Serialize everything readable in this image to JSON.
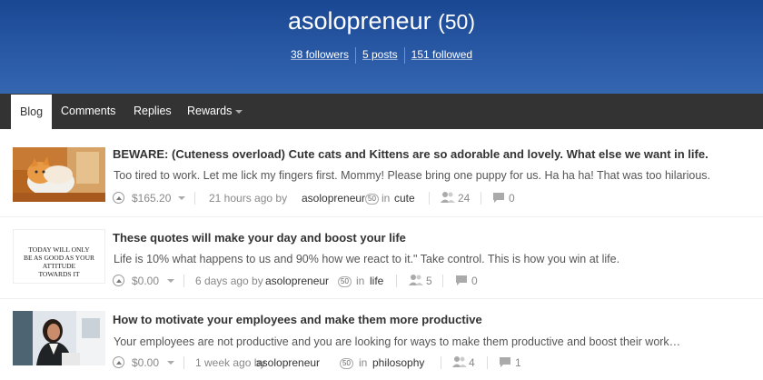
{
  "profile": {
    "username": "asolopreneur",
    "reputation": "(50)",
    "followers": "38 followers",
    "posts": "5 posts",
    "followed": "151 followed"
  },
  "tabs": [
    {
      "label": "Blog",
      "active": true
    },
    {
      "label": "Comments"
    },
    {
      "label": "Replies"
    },
    {
      "label": "Rewards"
    }
  ],
  "posts": [
    {
      "title": "BEWARE: (Cuteness overload) Cute cats and Kittens are so adorable and lovely. What else we want in life.",
      "body": "Too tired to work.   Let me lick my fingers first. Mommy! Please bring one puppy for us. Ha ha ha! That was too hilarious.",
      "payout": "$165.20",
      "time": "21 hours ago by",
      "author": "asolopreneur",
      "author_rep": "50",
      "in": "in",
      "tag": "cute",
      "voters": "24",
      "comments": "0"
    },
    {
      "title": "These quotes will make your day and boost your life",
      "body": "Life is 10% what happens to us and 90% how we react to it.\" Take control.     This is how you win at life.",
      "thumb_text": [
        "TODAY WILL ONLY",
        "BE AS GOOD AS YOUR",
        "ATTITUDE",
        "TOWARDS IT"
      ],
      "payout": "$0.00",
      "time": "6 days ago by",
      "author": "asolopreneur",
      "author_rep": "50",
      "in": "in",
      "tag": "life",
      "voters": "5",
      "comments": "0"
    },
    {
      "title": "How to motivate your employees and make them more productive",
      "body": "Your employees are not productive and you are looking for ways to make them productive and boost their work…",
      "payout": "$0.00",
      "time": "1 week ago by",
      "author": "asolopreneur",
      "author_rep": "50",
      "in": "in",
      "tag": "philosophy",
      "voters": "4",
      "comments": "1"
    }
  ]
}
